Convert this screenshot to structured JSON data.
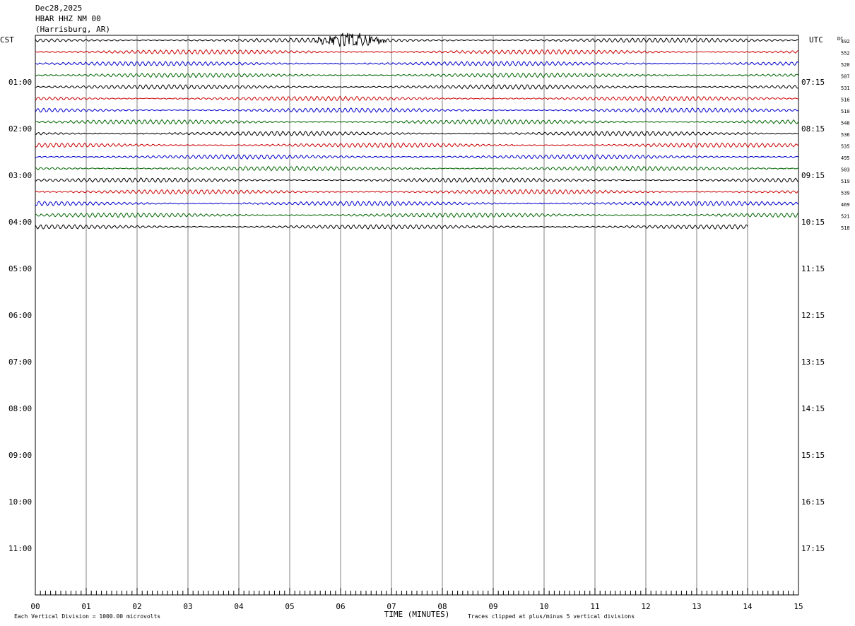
{
  "header": {
    "date": "Dec28,2025",
    "station": "HBAR HHZ NM 00",
    "location": "(Harrisburg, AR)"
  },
  "left_tz": "CST",
  "right_tz": "UTC",
  "dc_label": "DC",
  "footer": {
    "scale_note": "Each Vertical Division = 1000.00 microvolts",
    "clip_note": "Traces clipped at plus/minus 5 vertical divisions"
  },
  "colors": {
    "black": "#000000",
    "red": "#cc0000",
    "blue": "#0000cc",
    "green": "#006600",
    "grid": "#808080"
  },
  "chart_data": {
    "type": "line",
    "title": "",
    "xlabel": "TIME (MINUTES)",
    "x_ticks": [
      "00",
      "01",
      "02",
      "03",
      "04",
      "05",
      "06",
      "07",
      "08",
      "09",
      "10",
      "11",
      "12",
      "13",
      "14",
      "15"
    ],
    "xlim": [
      0,
      15
    ],
    "left_hour_labels": [
      "01:00",
      "02:00",
      "03:00",
      "04:00",
      "05:00",
      "06:00",
      "07:00",
      "08:00",
      "09:00",
      "10:00",
      "11:00"
    ],
    "right_hour_labels": [
      "07:15",
      "08:15",
      "09:15",
      "10:15",
      "11:15",
      "12:15",
      "13:15",
      "14:15",
      "15:15",
      "16:15",
      "17:15"
    ],
    "trace_color_cycle": [
      "black",
      "red",
      "blue",
      "green"
    ],
    "traces_recorded": 17,
    "trace_end_minute_last": 14,
    "dc_offsets": [
      "492",
      "552",
      "520",
      "507",
      "531",
      "516",
      "510",
      "548",
      "536",
      "535",
      "495",
      "503",
      "519",
      "539",
      "469",
      "521",
      "518"
    ],
    "events": [
      {
        "trace": 1,
        "minute_start": 5.5,
        "minute_end": 6.9,
        "description": "high amplitude burst"
      }
    ]
  }
}
